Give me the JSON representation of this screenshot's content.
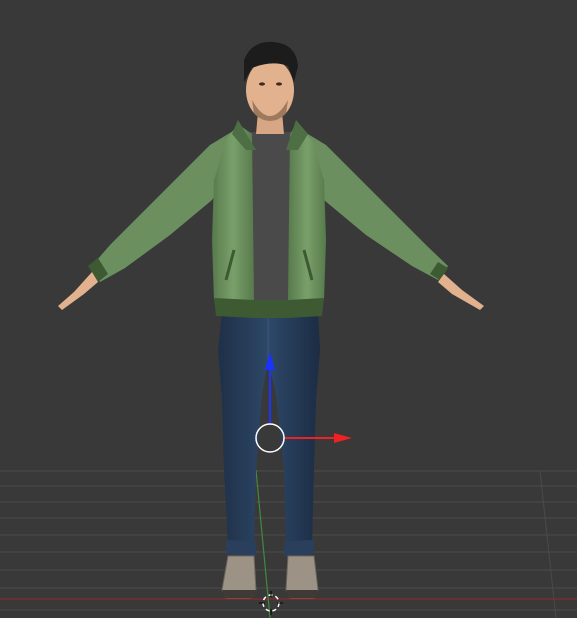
{
  "viewport": {
    "background_color": "#393939",
    "grid_color": "#4a4a4a",
    "x_axis_color": "#8a2a2a",
    "y_axis_color": "#3f8a3f"
  },
  "gizmo": {
    "z_axis_color": "#1a33ff",
    "x_axis_color": "#ee2222",
    "center_icon": "circle-widget-icon",
    "origin_icon": "3d-cursor-icon"
  },
  "character": {
    "jacket_color": "#6b8f5e",
    "shirt_color": "#4a4a4a",
    "jeans_color": "#243750",
    "hair_color": "#1c1c1c",
    "skin_color": "#e2b28f",
    "shoe_color": "#9c9286"
  }
}
